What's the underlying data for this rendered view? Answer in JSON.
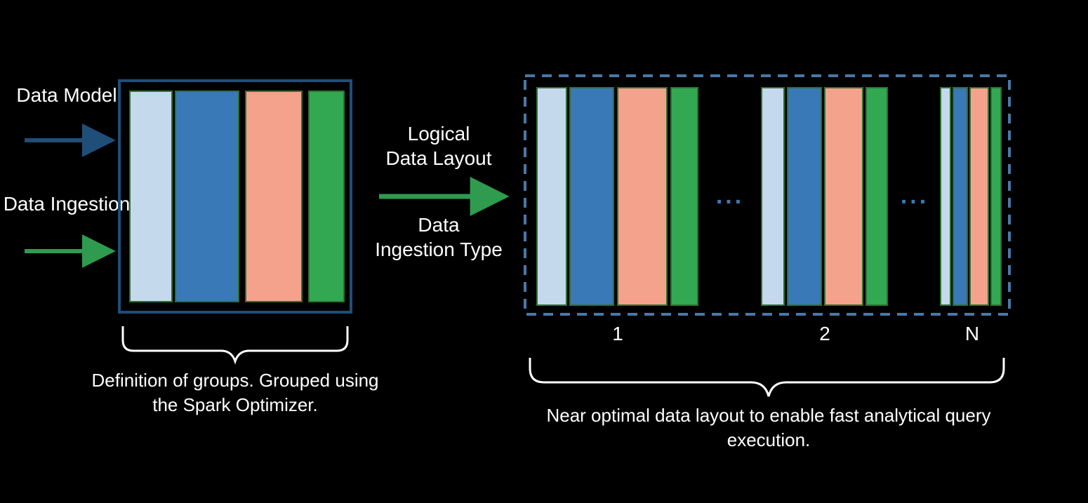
{
  "labels": {
    "data_model": "Data Model",
    "logical_arrow": "Logical Data Layout",
    "data_ingestion": "Data Ingestion",
    "ingestion_arrow": "Data Ingestion Type",
    "model_bracket": "Definition of groups. Grouped using the Spark Optimizer.",
    "layout_bracket": "Near optimal data layout to enable fast analytical query execution.",
    "group_large": "1",
    "group_medium": "2",
    "group_small": "N",
    "ellipsis": "..."
  },
  "colors": {
    "arrow_blue": "#1f4e79",
    "arrow_green": "#2e9b4f",
    "box_border": "#1f4e79",
    "dash_border": "#4a78a8",
    "bar_lightblue": "#c5d9ed",
    "bar_blue": "#3a79b7",
    "bar_salmon": "#f4a28c",
    "bar_green": "#33a852",
    "bar_outline": "#2e7030",
    "bracket": "#ffffff",
    "text": "#ffffff"
  }
}
